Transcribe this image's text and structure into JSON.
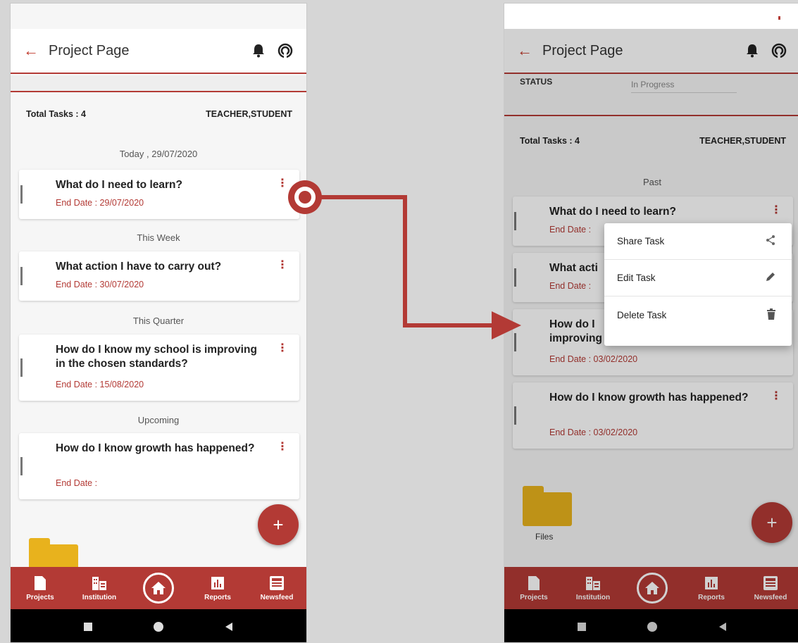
{
  "left": {
    "app_title": "Project Page",
    "summary": {
      "total_tasks": "Total Tasks : 4",
      "roles": "TEACHER,STUDENT"
    },
    "sections": [
      {
        "label": "Today , 29/07/2020",
        "task": {
          "title": "What do I need to learn?",
          "end_date": "End Date : 29/07/2020"
        }
      },
      {
        "label": "This Week",
        "task": {
          "title": "What action I have to carry out?",
          "end_date": "End Date : 30/07/2020"
        }
      },
      {
        "label": "This Quarter",
        "task": {
          "title": "How do I know my school is improving in the chosen standards?",
          "end_date": "End Date : 15/08/2020"
        }
      },
      {
        "label": "Upcoming",
        "task": {
          "title": "How do I know growth has happened?",
          "end_date": "End Date :"
        }
      }
    ]
  },
  "right": {
    "app_title": "Project Page",
    "status": {
      "label": "STATUS",
      "value": "In Progress"
    },
    "summary": {
      "total_tasks": "Total Tasks : 4",
      "roles": "TEACHER,STUDENT"
    },
    "section_label": "Past",
    "tasks": [
      {
        "title": "What do I need to learn?",
        "end_date": "End Date :"
      },
      {
        "title": "What acti",
        "end_date": "End Date :"
      },
      {
        "title": "How do I improving",
        "end_date": "End Date : 03/02/2020"
      },
      {
        "title": "How do I know growth has happened?",
        "end_date": "End Date : 03/02/2020"
      }
    ],
    "menu": [
      {
        "label": "Share Task",
        "icon": "share-icon"
      },
      {
        "label": "Edit Task",
        "icon": "edit-icon"
      },
      {
        "label": "Delete Task",
        "icon": "delete-icon"
      }
    ],
    "files_label": "Files"
  },
  "bottom_nav": [
    "Projects",
    "Institution",
    "Reports",
    "Newsfeed"
  ],
  "fab_label": "+",
  "colors": {
    "accent": "#b33a35",
    "folder": "#e8b21d"
  }
}
